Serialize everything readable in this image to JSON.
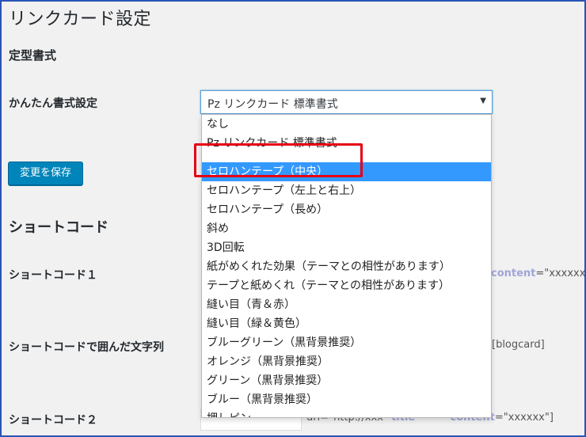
{
  "page": {
    "title": "リンクカード設定",
    "section_title": "定型書式"
  },
  "format_setting": {
    "label": "かんたん書式設定",
    "selected_value": "Pz リンクカード 標準書式",
    "options": [
      "なし",
      "Pz リンクカード 標準書式",
      "セロハンテープ（中央）",
      "セロハンテープ（左上と右上）",
      "セロハンテープ（長め）",
      "斜め",
      "3D回転",
      "紙がめくれた効果（テーマとの相性があります）",
      "テープと紙めくれ（テーマとの相性があります）",
      "縫い目（青＆赤）",
      "縫い目（緑＆黄色）",
      "ブルーグリーン（黒背景推奨）",
      "オレンジ（黒背景推奨）",
      "グリーン（黒背景推奨）",
      "ブルー（黒背景推奨）",
      "押しピン"
    ],
    "highlighted_option": "セロハンテープ（中央）"
  },
  "save_button": "変更を保存",
  "shortcode": {
    "heading": "ショートコード",
    "row1_label": "ショートコード１",
    "row1_code_attr": "content",
    "row1_code_val": "=\"xxxxxx\"]",
    "row2_label": "ショートコードで囲んだ文字列",
    "row2_code": "[blogcard]",
    "row3_label": "ショートコード２",
    "row3_code_prefix": "url=\"http://xxx\"",
    "row3_code_title": "title",
    "row3_code_attr": "content",
    "row3_code_val": "=\"xxxxxx\"]"
  },
  "colors": {
    "primary_button": "#0085ba",
    "selected_option": "#3399ff",
    "highlight_box": "#e60012",
    "frame_border": "#2a53b5"
  }
}
